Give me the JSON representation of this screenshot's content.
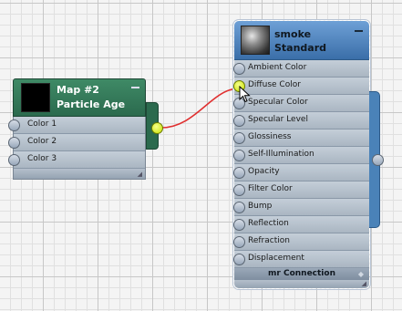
{
  "nodes": {
    "map": {
      "title_line1": "Map #2",
      "title_line2": "Particle Age",
      "header_color": "#2b6a4e",
      "slots": [
        {
          "label": "Color 1"
        },
        {
          "label": "Color 2"
        },
        {
          "label": "Color 3"
        }
      ],
      "output_socket_color": "#d4f000"
    },
    "material": {
      "title_line1": "smoke",
      "title_line2": "Standard",
      "header_color": "#3a6ea8",
      "slots": [
        {
          "label": "Ambient Color"
        },
        {
          "label": "Diffuse Color"
        },
        {
          "label": "Specular Color"
        },
        {
          "label": "Specular Level"
        },
        {
          "label": "Glossiness"
        },
        {
          "label": "Self-Illumination"
        },
        {
          "label": "Opacity"
        },
        {
          "label": "Filter Color"
        },
        {
          "label": "Bump"
        },
        {
          "label": "Reflection"
        },
        {
          "label": "Refraction"
        },
        {
          "label": "Displacement"
        }
      ],
      "footer_label": "mr Connection",
      "connected_slot": "Diffuse Color",
      "connection_color": "#e03030"
    }
  }
}
